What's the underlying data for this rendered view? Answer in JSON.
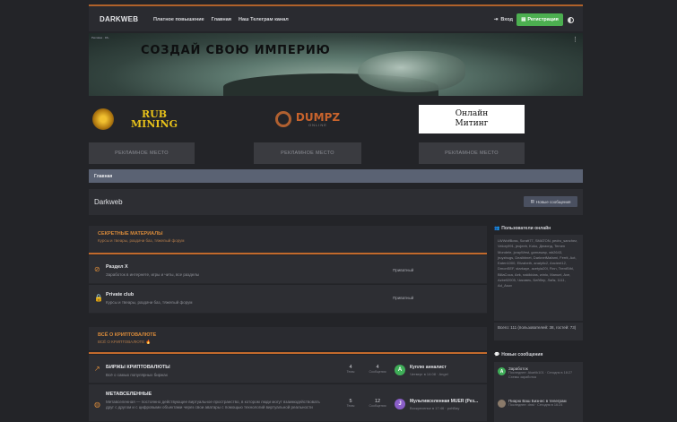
{
  "header": {
    "logo": "DARKWEB",
    "nav": [
      "Платное повышение",
      "Главная",
      "Наш Телеграм канал"
    ],
    "login_label": "Вход",
    "register_label": "Регистрация"
  },
  "banner": {
    "title": "СОЗДАЙ СВОЮ ИМПЕРИЮ",
    "corner_text": "Реклама · 18+"
  },
  "ads": {
    "rub_mining": "RUB\nMINING",
    "dumpz": "DUMPZ",
    "dumpz_sub": "ONLINE",
    "meeting": "Онлайн\nМитинг",
    "ad_slots": [
      "РЕКЛАМНОЕ МЕСТО",
      "РЕКЛАМНОЕ МЕСТО",
      "РЕКЛАМНОЕ МЕСТО"
    ]
  },
  "breadcrumb": "Главная",
  "page_title": "Darkweb",
  "new_posts_button": "Новые сообщения",
  "sections": [
    {
      "title": "СЕКРЕТНЫЕ МАТЕРИАЛЫ",
      "subtitle": "Курсы и твеары, раздачи баз, тяжелый форум",
      "nodes": [
        {
          "name": "Раздел X",
          "desc": "Заработок в интернете, игры и читы, все разделы",
          "last": "Приватный"
        },
        {
          "name": "Private club",
          "desc": "Курсы и твеары, раздачи баз, тяжелый форум",
          "last": "Приватный"
        }
      ]
    },
    {
      "title": "ВСЁ О КРИПТОВАЛЮТЕ",
      "subtitle": "ВСЁ О КРИПТОВАЛЮТЕ 🔥",
      "nodes": [
        {
          "name": "БИРЖЫ КРИПТОВАЛЮТЫ",
          "desc": "Всё о самых популярных биржах",
          "threads": "4",
          "threads_label": "Темы",
          "posts": "4",
          "posts_label": "Сообщения",
          "avatar": "A",
          "avatar_color": "#3fae58",
          "last_title": "Куплю анналист",
          "last_meta": "Четверг в 14:08 · Angel"
        },
        {
          "name": "МЕТАВСЕЛЕННЫЕ",
          "desc": "Метавселенная — постоянно действующее виртуальное пространство, в котором люди могут взаимодействовать друг с другом и с цифровыми объектами через свои аватары с помощью технологий виртуальной реальности",
          "threads": "5",
          "threads_label": "Темы",
          "posts": "12",
          "posts_label": "Сообщения",
          "avatar": "J",
          "avatar_color": "#8a5ec8",
          "last_title": "Мультивселенная MUER (Рез...",
          "last_meta": "Воскресенье в 17:46 · pohBay"
        }
      ]
    }
  ],
  "sidebar": {
    "online_title": "Пользователи онлайн",
    "online_users": "LWWolfBoss, Scratt77, SMATON, pedro_sanchez, Velory991, jeojeeb, Koko, Демонд, Temen Mondele, jcrayWest, garnawap, wb2643, jruyzbugs, Dealbbnet, DarknetMafami, Ferrit, Aot, Eaten1000, Elizabeth, analytic2, Ancient12, DmonSEF, starkaye, acetyla20l, Finn, TrentSthl, BillaCoca, Aek, nakikidas, winlo, Manuel, Axe, Azbell2005, Чиковеь, Бейбер, Лайк, 1111, Ad_Asov",
    "online_total": "Всего: 111 (пользователей: 38, гостей: 73)",
    "new_posts_title": "Новые сообщения",
    "new_posts": [
      {
        "avatar": "A",
        "color": "#3fae58",
        "title": "Заработок",
        "meta": "Последнее: Akartik101 · Сегодня в 18:27",
        "sub": "Схемы заработка"
      },
      {
        "avatar": "",
        "color": "#8a7a6a",
        "title": "Пиарю Ваш Бизнес в телеграм",
        "meta": "Последнее: dnst · Сегодня в 16:24",
        "sub": ""
      }
    ]
  },
  "colors": {
    "accent": "#c26a2c",
    "register": "#4caf50",
    "breadcrumb": "#5a6273"
  }
}
